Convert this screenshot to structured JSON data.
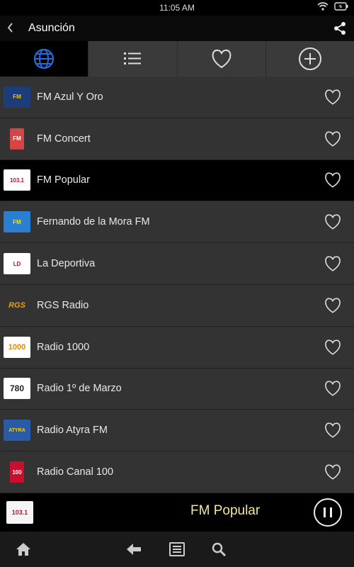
{
  "status": {
    "time": "11:05 AM"
  },
  "header": {
    "title": "Asunción"
  },
  "tabs": [
    {
      "icon": "globe-icon",
      "active": true
    },
    {
      "icon": "list-icon",
      "active": false
    },
    {
      "icon": "heart-outline-icon",
      "active": false
    },
    {
      "icon": "add-circle-icon",
      "active": false
    }
  ],
  "stations": [
    {
      "name": "FM Azul Y Oro",
      "logo_text": "FM"
    },
    {
      "name": "FM Concert",
      "logo_text": "FM"
    },
    {
      "name": "FM Popular",
      "logo_text": "103.1"
    },
    {
      "name": "Fernando de la Mora FM",
      "logo_text": "FM"
    },
    {
      "name": "La Deportiva",
      "logo_text": "LD"
    },
    {
      "name": "RGS Radio",
      "logo_text": "RGS"
    },
    {
      "name": "Radio 1000",
      "logo_text": "1000"
    },
    {
      "name": "Radio 1º de Marzo",
      "logo_text": "780"
    },
    {
      "name": "Radio Atyra FM",
      "logo_text": "ATYRA"
    },
    {
      "name": "Radio Canal 100",
      "logo_text": "100"
    }
  ],
  "player": {
    "now_playing": "FM Popular",
    "logo_text": "103.1"
  },
  "colors": {
    "selected_row": "#000000",
    "list_bg": "#333333",
    "now_playing_text": "#f3e6a0",
    "accent_blue": "#2a6ad8"
  }
}
